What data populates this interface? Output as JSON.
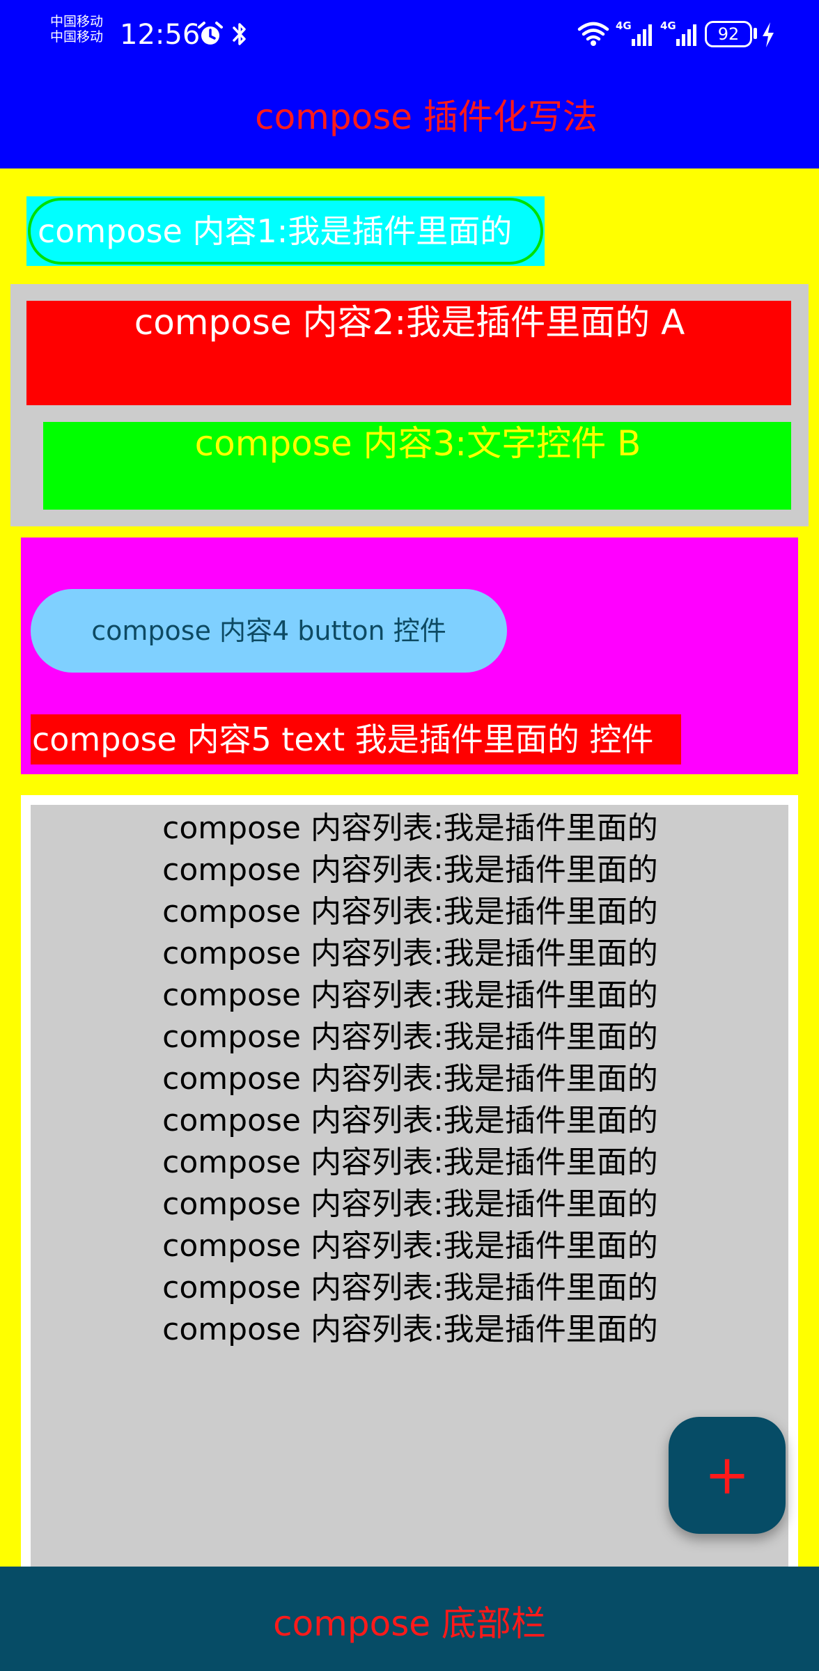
{
  "status_bar": {
    "carrier_1": "中国移动",
    "carrier_2": "中国移动",
    "time": "12:56",
    "signal_1_label": "4G",
    "signal_2_label": "4G",
    "battery": "92"
  },
  "top_bar": {
    "title": "compose 插件化写法"
  },
  "content1": {
    "text": "compose 内容1:我是插件里面的"
  },
  "content2": {
    "text": "compose 内容2:我是插件里面的 A"
  },
  "content3": {
    "text": "compose 内容3:文字控件 B"
  },
  "content4": {
    "button_label": "compose 内容4 button 控件"
  },
  "content5": {
    "text": "compose 内容5 text 我是插件里面的 控件"
  },
  "list": {
    "items": [
      "compose 内容列表:我是插件里面的",
      "compose 内容列表:我是插件里面的",
      "compose 内容列表:我是插件里面的",
      "compose 内容列表:我是插件里面的",
      "compose 内容列表:我是插件里面的",
      "compose 内容列表:我是插件里面的",
      "compose 内容列表:我是插件里面的",
      "compose 内容列表:我是插件里面的",
      "compose 内容列表:我是插件里面的",
      "compose 内容列表:我是插件里面的",
      "compose 内容列表:我是插件里面的",
      "compose 内容列表:我是插件里面的",
      "compose 内容列表:我是插件里面的"
    ]
  },
  "fab": {
    "label": "+"
  },
  "bottom_bar": {
    "title": "compose 底部栏"
  },
  "colors": {
    "top_bar": "#0000ff",
    "page_background": "#ffff00",
    "title_text": "#ff1a1a",
    "bottom_bar": "#064c66",
    "fab": "#064c66",
    "button": "#7fd0ff"
  },
  "icons": [
    "alarm-icon",
    "bluetooth-icon",
    "wifi-icon",
    "signal-icon",
    "battery-icon",
    "charging-icon",
    "plus-icon"
  ]
}
